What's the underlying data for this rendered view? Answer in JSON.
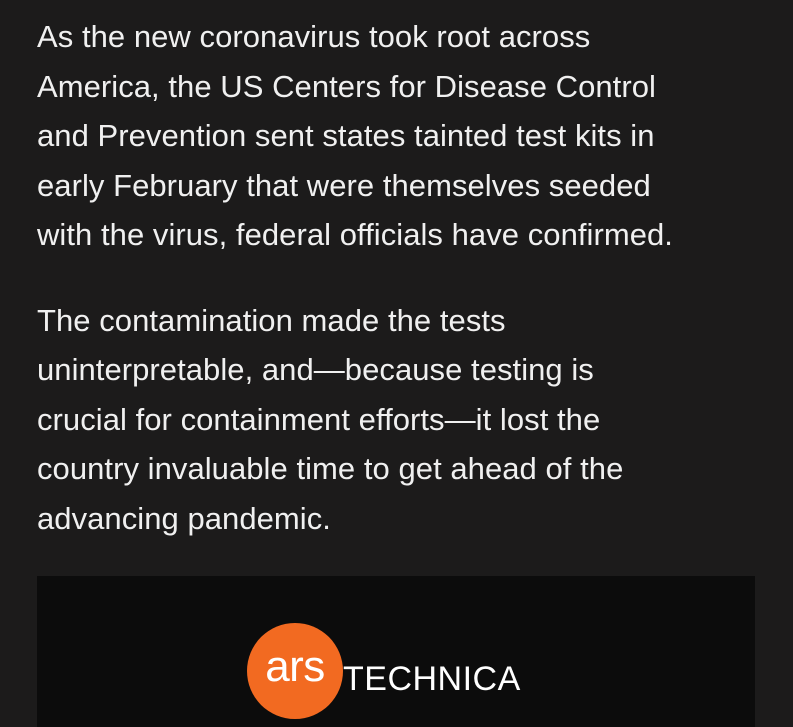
{
  "article": {
    "paragraphs": [
      "As the new coronavirus took root across\nAmerica, the US Centers for Disease Control\nand Prevention sent states tainted test kits in\nearly February that were themselves seeded\nwith the virus, federal officials have confirmed.",
      "The contamination made the tests\nuninterpretable, and—because testing is\ncrucial for containment efforts—it lost the\ncountry invaluable time to get ahead of the\nadvancing pandemic."
    ]
  },
  "banner": {
    "logo_ars": "ars",
    "logo_technica": "TECHNICA",
    "logo_color": "#f26a21"
  }
}
